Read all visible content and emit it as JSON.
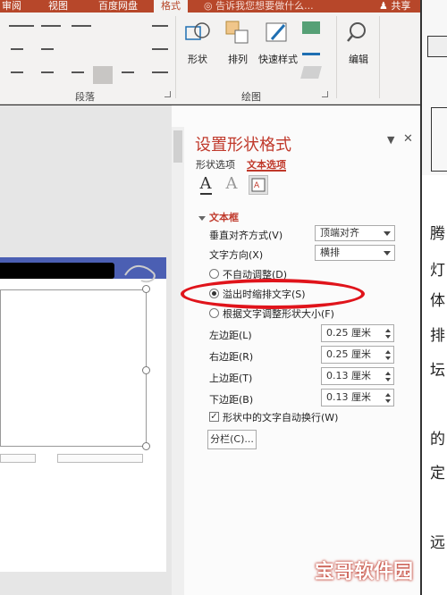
{
  "ribbon_tabs": [
    "审阅",
    "视图",
    "百度网盘",
    "格式"
  ],
  "tell_me": "告诉我您想要做什么...",
  "share": "共享",
  "ribbon": {
    "paragraph_label": "段落",
    "drawing_label": "绘图",
    "shape_label": "形状",
    "arrange_label": "排列",
    "quick_styles_label": "快速样式",
    "edit_label": "编辑"
  },
  "pane": {
    "title": "设置形状格式",
    "tab_shape": "形状选项",
    "tab_text": "文本选项",
    "icons": [
      "text-fill-outline",
      "text-effects",
      "textbox"
    ],
    "section": "文本框",
    "vertical_align_label": "垂直对齐方式(V)",
    "vertical_align_value": "顶端对齐",
    "text_direction_label": "文字方向(X)",
    "text_direction_value": "横排",
    "radio_no_autofit": "不自动调整(D)",
    "radio_shrink": "溢出时缩排文字(S)",
    "radio_resize": "根据文字调整形状大小(F)",
    "left_margin_label": "左边距(L)",
    "left_margin_value": "0.25 厘米",
    "right_margin_label": "右边距(R)",
    "right_margin_value": "0.25 厘米",
    "top_margin_label": "上边距(T)",
    "top_margin_value": "0.13 厘米",
    "bottom_margin_label": "下边距(B)",
    "bottom_margin_value": "0.13 厘米",
    "wrap_label": "形状中的文字自动换行(W)",
    "columns_button": "分栏(C)...",
    "selected_radio": "shrink"
  },
  "right_doc_chars": [
    "腾",
    "灯",
    "体",
    "排",
    "坛",
    "的",
    "定",
    "远"
  ],
  "watermark": "宝哥软件园",
  "colors": {
    "accent": "#b7472a",
    "pane_accent": "#c0392b",
    "oval": "#e0141b"
  }
}
